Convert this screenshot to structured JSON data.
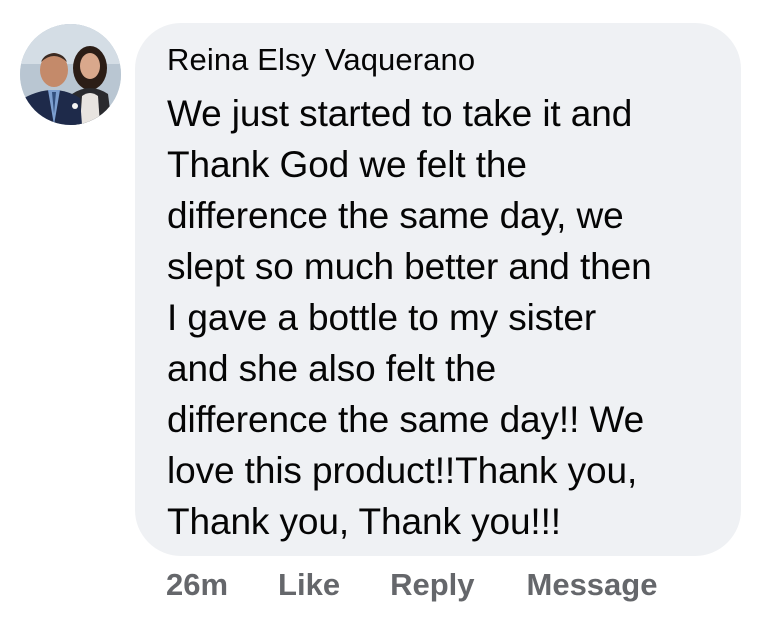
{
  "comment": {
    "author": "Reina Elsy Vaquerano",
    "text": "We just started to take it and\nThank God we felt the\ndifference the same day, we\nslept so much better and then\nI gave a bottle to my sister\nand she also felt the\ndifference the same day!! We\nlove this product!!Thank you,\nThank you, Thank you!!!",
    "timestamp": "26m",
    "actions": {
      "like": "Like",
      "reply": "Reply",
      "message": "Message"
    }
  },
  "colors": {
    "bubble_background": "#eff1f4",
    "text": "#050505",
    "action_text": "#65676b"
  }
}
